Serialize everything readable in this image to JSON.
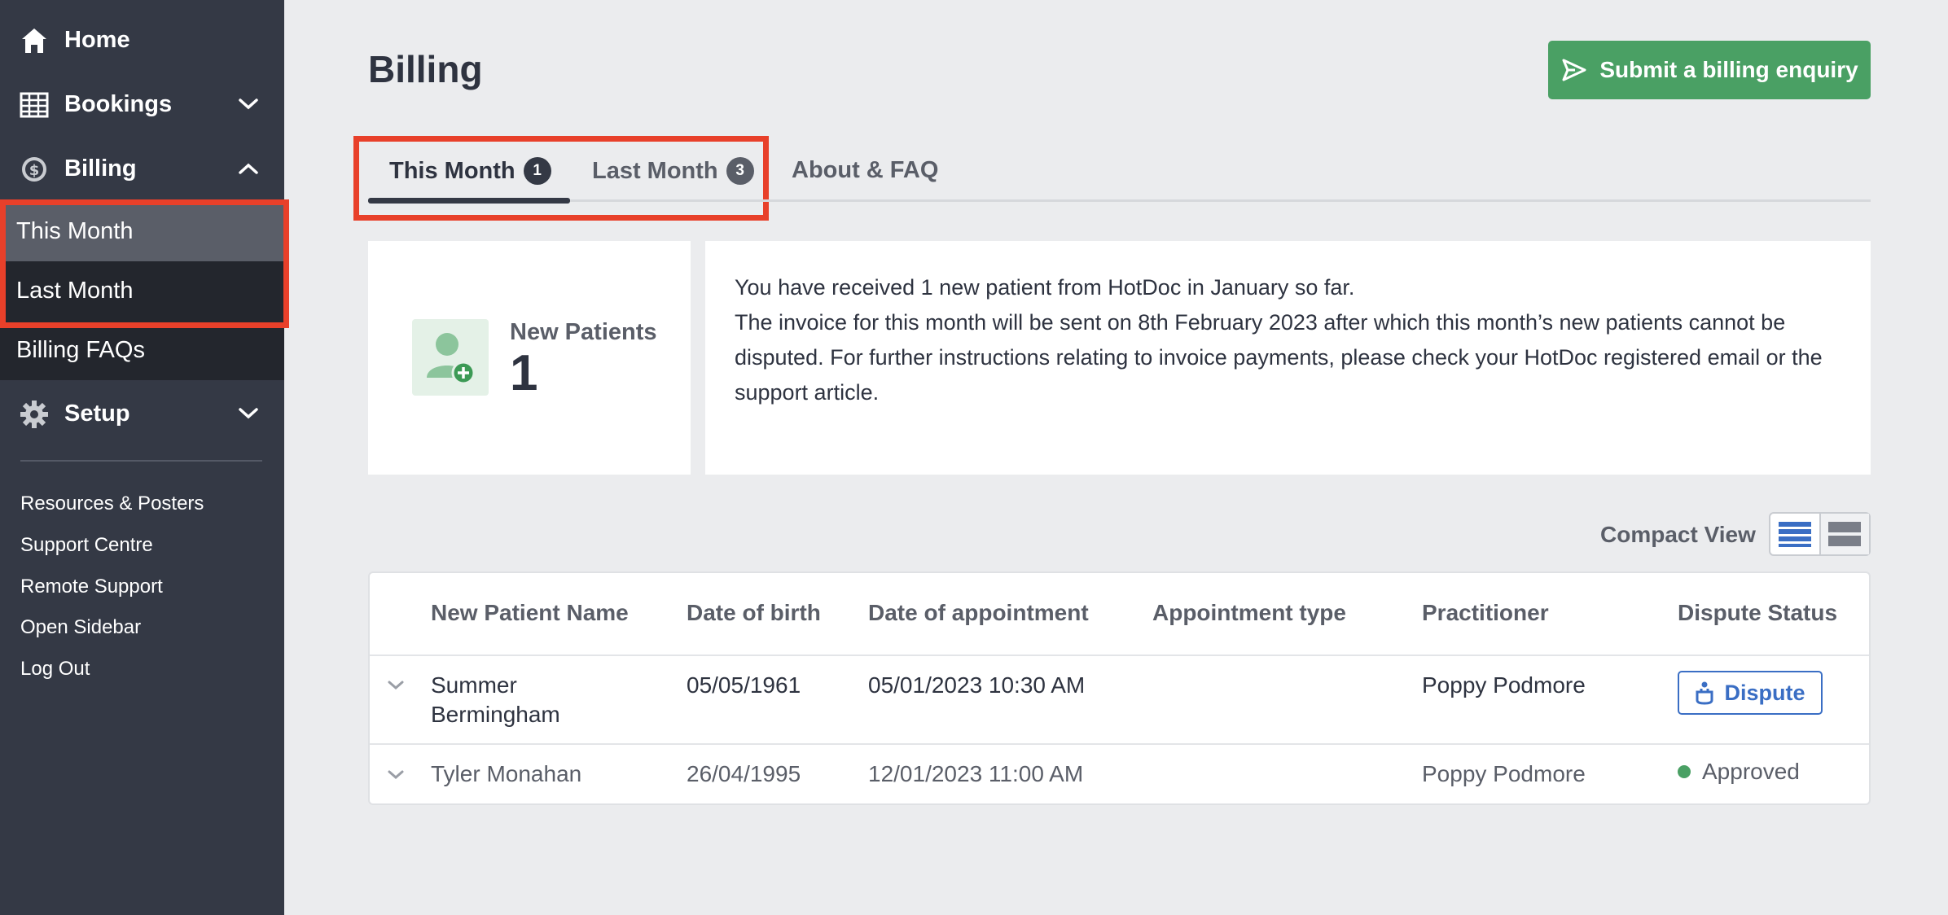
{
  "sidebar": {
    "home": "Home",
    "bookings": "Bookings",
    "billing": "Billing",
    "this_month": "This Month",
    "last_month": "Last Month",
    "billing_faqs": "Billing FAQs",
    "setup": "Setup",
    "links": [
      "Resources & Posters",
      "Support Centre",
      "Remote Support",
      "Open Sidebar",
      "Log Out"
    ]
  },
  "header": {
    "title": "Billing",
    "enquiry_button": "Submit a billing enquiry"
  },
  "tabs": [
    {
      "label": "This Month",
      "badge": "1"
    },
    {
      "label": "Last Month",
      "badge": "3"
    },
    {
      "label": "About & FAQ"
    }
  ],
  "summary": {
    "label": "New Patients",
    "value": "1",
    "line1": "You have received 1 new patient from HotDoc in January so far.",
    "line2": "The invoice for this month will be sent on 8th February 2023 after which this month’s new patients cannot be disputed. For further instructions relating to invoice payments, please check your HotDoc registered email or the support article."
  },
  "view": {
    "compact_label": "Compact View"
  },
  "table": {
    "headers": [
      "New Patient Name",
      "Date of birth",
      "Date of appointment",
      "Appointment type",
      "Practitioner",
      "Dispute Status"
    ],
    "rows": [
      {
        "name": "Summer Bermingham",
        "dob": "05/05/1961",
        "appointment": "05/01/2023 10:30 AM",
        "type": "",
        "practitioner": "Poppy Podmore",
        "status": "Dispute"
      },
      {
        "name": "Tyler Monahan",
        "dob": "26/04/1995",
        "appointment": "12/01/2023 11:00 AM",
        "type": "",
        "practitioner": "Poppy Podmore",
        "status": "Approved"
      }
    ]
  },
  "colors": {
    "sidebar_bg": "#343945",
    "accent_green": "#4aa064",
    "link_blue": "#3a6ec4",
    "highlight_red": "#e8402a"
  }
}
